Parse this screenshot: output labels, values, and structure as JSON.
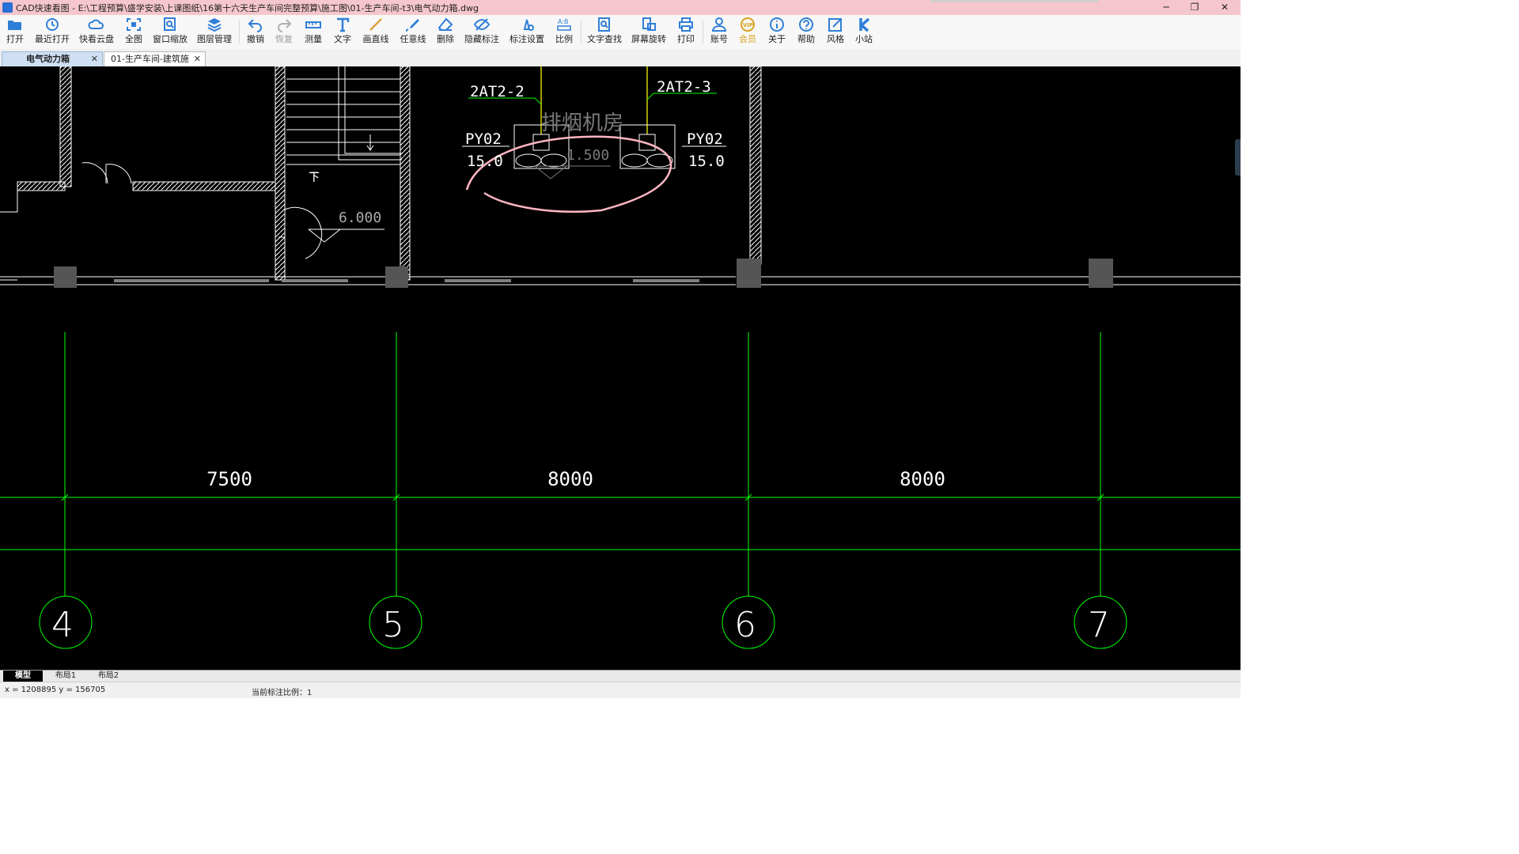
{
  "window": {
    "title": "CAD快速看图 - E:\\工程预算\\盛学安装\\上课图纸\\16第十六天生产车间完整预算\\施工图\\01-生产车间-t3\\电气动力箱.dwg",
    "minimize": "─",
    "restore": "❐",
    "close": "✕"
  },
  "toolbar": {
    "open": "打开",
    "recent": "最近打开",
    "cloud": "快看云盘",
    "fit": "全图",
    "window_zoom": "窗口缩放",
    "layers": "图层管理",
    "undo": "撤销",
    "redo": "恢复",
    "measure": "测量",
    "text": "文字",
    "line": "画直线",
    "freehand": "任意线",
    "delete": "删除",
    "hide_marks": "隐藏标注",
    "mark_settings": "标注设置",
    "scale": "比例",
    "find_text": "文字查找",
    "rotate": "屏幕旋转",
    "print": "打印",
    "account": "账号",
    "vip": "会员",
    "about": "关于",
    "help": "帮助",
    "style": "风格",
    "station": "小站"
  },
  "icons": {
    "accent": "#2f7fd8",
    "vip": "#d9a21b",
    "pen": "#e0a040"
  },
  "doc_tabs": [
    {
      "label": "电气动力箱",
      "active": true
    },
    {
      "label": "01-生产车间-建筑施…",
      "active": false
    }
  ],
  "drawing": {
    "colors": {
      "axis": "#00ff00",
      "wall": "#ffffff",
      "markup": "#ffb6c1",
      "column": "#555555",
      "feeder": "#d4d400",
      "faded_text": "#7a7a7a"
    },
    "labels": {
      "feeder_a": "2AT2-2",
      "feeder_b": "2AT2-3",
      "fan_a_code": "PY02",
      "fan_a_power": "15.0",
      "fan_b_code": "PY02",
      "fan_b_power": "15.0",
      "room_name": "排烟机房",
      "room_elev": "1.500",
      "stair_elev": "6.000",
      "stair_down": "下"
    },
    "dimensions": [
      "7500",
      "8000",
      "8000"
    ],
    "axes": [
      "4",
      "5",
      "6",
      "7"
    ]
  },
  "layout_tabs": [
    "模型",
    "布局1",
    "布局2"
  ],
  "status": {
    "coords": "x = 1208895  y = 156705",
    "scale": "当前标注比例：1"
  }
}
